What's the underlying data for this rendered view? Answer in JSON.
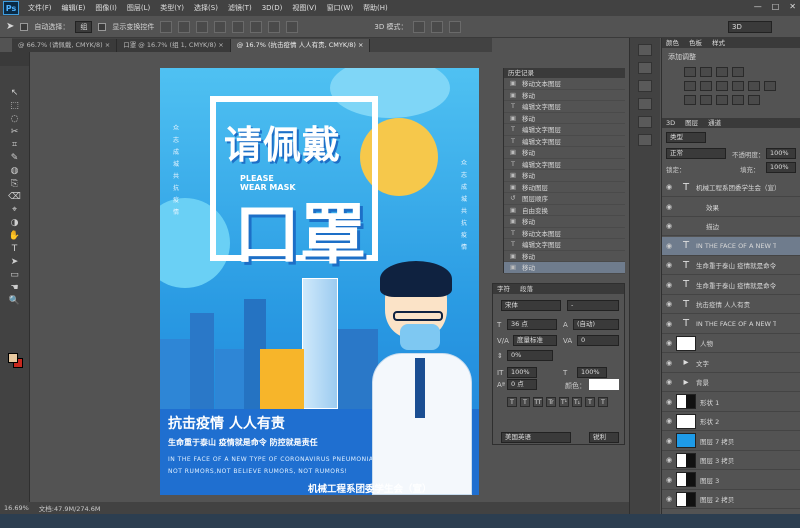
{
  "app": {
    "logo": "Ps"
  },
  "menu": [
    "文件(F)",
    "编辑(E)",
    "图像(I)",
    "图层(L)",
    "类型(Y)",
    "选择(S)",
    "滤镜(T)",
    "3D(D)",
    "视图(V)",
    "窗口(W)",
    "帮助(H)"
  ],
  "window_controls": {
    "minimize": "—",
    "maximize": "□",
    "close": "✕"
  },
  "options": {
    "auto_select_label": "自动选择：",
    "auto_select_value": "组",
    "transform_label": "显示变换控件",
    "mode_3d": "3D 模式：",
    "workspace": "3D"
  },
  "tabs": [
    {
      "label": "@ 66.7% (请佩戴, CMYK/8) ×",
      "active": false
    },
    {
      "label": "口罩 @ 16.7% (组 1, CMYK/8) ×",
      "active": false
    },
    {
      "label": "@ 16.7% (抗击疫情 人人有责, CMYK/8) ×",
      "active": true
    }
  ],
  "tools": [
    "↖",
    "⬚",
    "◌",
    "✂",
    "⌗",
    "✎",
    "◍",
    "⎘",
    "⌫",
    "⌖",
    "◑",
    "✋",
    "T",
    "➤",
    "▭",
    "☚",
    "🔍"
  ],
  "poster": {
    "side_left": "众志成城共抗疫情",
    "side_right": "众志成城共抗疫情",
    "title1": "请佩戴",
    "title_en_1": "PLEASE",
    "title_en_2": "WEAR MASK",
    "title2": "口罩",
    "slogan": "抗击疫情  人人有责",
    "slogan_sub": "生命重于泰山  疫情就是命令  防控就是责任",
    "english": "IN THE FACE OF A NEW TYPE OF CORONAVIRUS PNEUMONIA, NOT RUMORS,NOT BELIEVE RUMORS, NOT RUMORS!",
    "org": "机械工程系团委学生会（宣）"
  },
  "history": {
    "title": "历史记录",
    "items": [
      {
        "icon": "▣",
        "label": "移动文本图层"
      },
      {
        "icon": "▣",
        "label": "移动"
      },
      {
        "icon": "T",
        "label": "编辑文字图层"
      },
      {
        "icon": "▣",
        "label": "移动"
      },
      {
        "icon": "T",
        "label": "编辑文字图层"
      },
      {
        "icon": "T",
        "label": "编辑文字图层"
      },
      {
        "icon": "▣",
        "label": "移动"
      },
      {
        "icon": "T",
        "label": "编辑文字图层"
      },
      {
        "icon": "▣",
        "label": "移动"
      },
      {
        "icon": "▣",
        "label": "移动图层"
      },
      {
        "icon": "↺",
        "label": "图层顺序"
      },
      {
        "icon": "▣",
        "label": "自由变换"
      },
      {
        "icon": "▣",
        "label": "移动"
      },
      {
        "icon": "T",
        "label": "移动文本图层"
      },
      {
        "icon": "T",
        "label": "编辑文字图层"
      },
      {
        "icon": "▣",
        "label": "移动"
      },
      {
        "icon": "▣",
        "label": "移动"
      }
    ]
  },
  "character": {
    "tab1": "字符",
    "tab2": "段落",
    "font": "宋体",
    "style": "-",
    "size": "36 点",
    "leading": "(自动)",
    "kerning": "度量标准",
    "tracking": "0",
    "scale_h": "100%",
    "scale_v": "100%",
    "baseline": "0 点",
    "color_label": "颜色：",
    "vertical_scale_pct": "0%",
    "lang": "美国英语",
    "aa": "锐利",
    "style_buttons": [
      "T",
      "T",
      "TT",
      "Tr",
      "T¹",
      "T₁",
      "T",
      "T"
    ]
  },
  "adjustments": {
    "tabs": [
      "颜色",
      "色板",
      "样式"
    ],
    "add_label": "添加调整"
  },
  "layers": {
    "tabs": [
      "3D",
      "图层",
      "通道"
    ],
    "kind": "类型",
    "blend": "正常",
    "opacity_label": "不透明度：",
    "opacity": "100%",
    "lock_label": "锁定：",
    "fill_label": "填充：",
    "fill": "100%",
    "items": [
      {
        "type": "T",
        "name": "机械工程系团委学生会（宣）",
        "selected": false
      },
      {
        "type": "fx",
        "name": "效果",
        "selected": false
      },
      {
        "type": "fx",
        "name": "描边",
        "selected": false
      },
      {
        "type": "T",
        "name": "IN THE FACE OF A NEW TYPE",
        "selected": true
      },
      {
        "type": "T",
        "name": "生命重于泰山 疫情就是命令",
        "selected": false
      },
      {
        "type": "T",
        "name": "生命重于泰山 疫情就是命令",
        "selected": false
      },
      {
        "type": "T",
        "name": "抗击疫情 人人有责",
        "selected": false
      },
      {
        "type": "T",
        "name": "IN THE FACE OF A NEW TYPE",
        "selected": false
      },
      {
        "type": "img",
        "name": "人物",
        "selected": false
      },
      {
        "type": "grp",
        "name": "文字",
        "selected": false
      },
      {
        "type": "grp",
        "name": "背景",
        "selected": false
      },
      {
        "type": "mask",
        "name": "形状 1",
        "selected": false
      },
      {
        "type": "img",
        "name": "形状 2",
        "selected": false
      },
      {
        "type": "blue",
        "name": "图层 7 拷贝",
        "selected": false
      },
      {
        "type": "dark",
        "name": "图层 3 拷贝",
        "selected": false
      },
      {
        "type": "dark",
        "name": "图层 3",
        "selected": false
      },
      {
        "type": "dark",
        "name": "图层 2 拷贝",
        "selected": false
      }
    ]
  },
  "status": {
    "zoom": "16.69%",
    "doc": "文档:47.9M/274.6M"
  }
}
